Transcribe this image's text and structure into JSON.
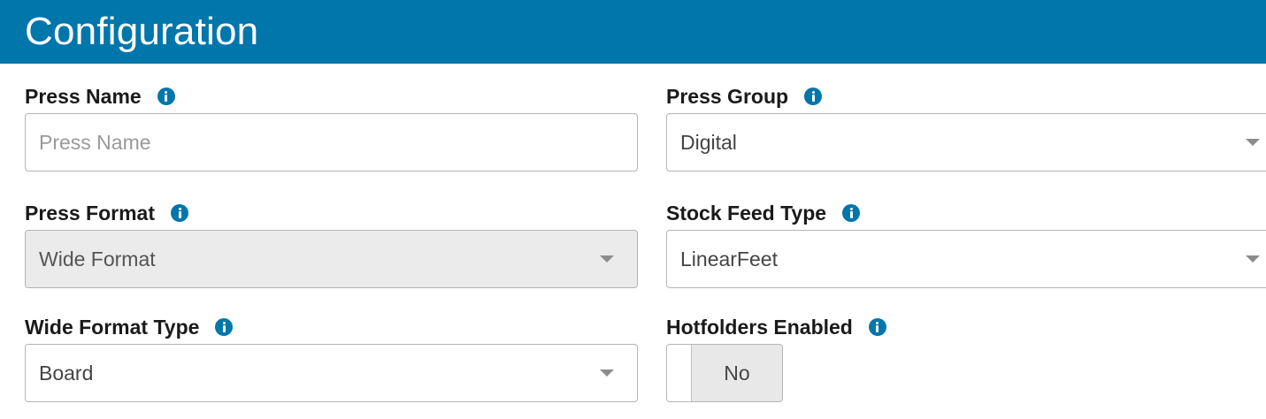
{
  "header": {
    "title": "Configuration"
  },
  "fields": {
    "press_name": {
      "label": "Press Name",
      "placeholder": "Press Name",
      "value": ""
    },
    "press_group": {
      "label": "Press Group",
      "value": "Digital"
    },
    "press_format": {
      "label": "Press Format",
      "value": "Wide Format",
      "disabled": true
    },
    "stock_feed_type": {
      "label": "Stock Feed Type",
      "value": "LinearFeet"
    },
    "wide_format_type": {
      "label": "Wide Format Type",
      "value": "Board"
    },
    "hotfolders_enabled": {
      "label": "Hotfolders Enabled",
      "value": "No"
    }
  },
  "icons": {
    "info": "info-icon",
    "dropdown": "chevron-down-icon"
  },
  "colors": {
    "header_bg": "#0176ab",
    "info_icon": "#0176ab",
    "disabled_bg": "#ebebeb"
  }
}
